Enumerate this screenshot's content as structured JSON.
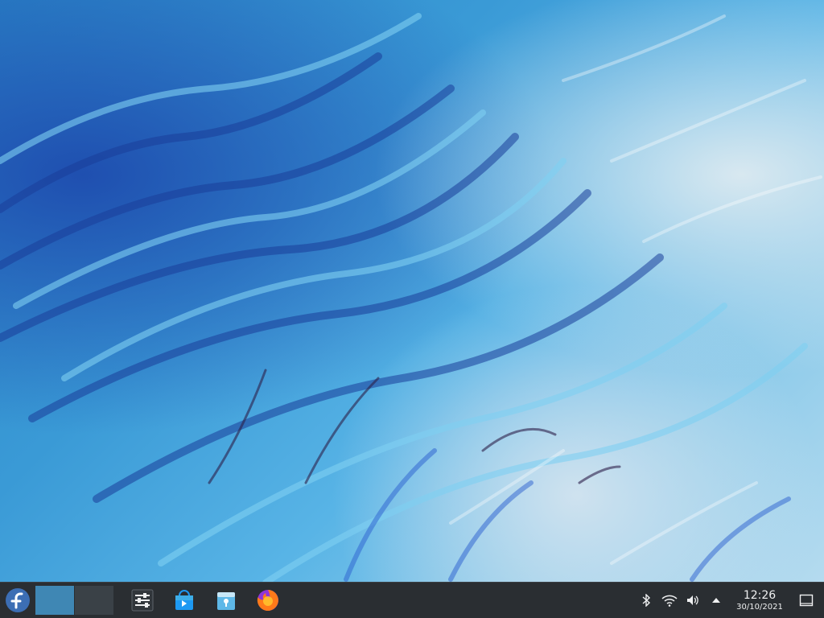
{
  "desktop": {
    "wallpaper": "blue marbled paper pattern",
    "colors": {
      "deep": "#1f4fb0",
      "mid": "#3a9ad6",
      "light": "#b5dbef",
      "panel": "#2a2e32"
    }
  },
  "taskbar": {
    "launcher_icon": "fedora-icon",
    "pager": {
      "active_desktop": 1,
      "desktops": 2
    },
    "tasks": [
      {
        "icon": "system-settings-icon"
      },
      {
        "icon": "discover-store-icon"
      },
      {
        "icon": "kwallet-icon"
      },
      {
        "icon": "firefox-icon"
      }
    ],
    "tray": [
      {
        "icon": "bluetooth-icon"
      },
      {
        "icon": "wifi-icon"
      },
      {
        "icon": "volume-icon"
      },
      {
        "icon": "expand-tray-icon"
      }
    ],
    "clock": {
      "time": "12:26",
      "date": "30/10/2021"
    },
    "show_desktop_icon": "show-desktop-icon"
  }
}
